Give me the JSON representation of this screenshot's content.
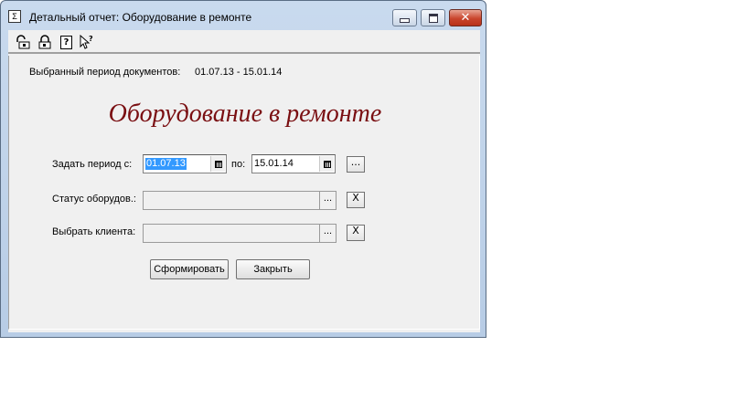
{
  "window": {
    "title": "Детальный отчет: Оборудование в ремонте",
    "title_icon_glyph": "Σ"
  },
  "toolbar": {
    "icons": [
      "open-lock-icon",
      "lock-icon",
      "help-icon",
      "context-help-icon"
    ]
  },
  "report": {
    "period_label": "Выбранный период документов:",
    "period_value": "01.07.13 - 15.01.14",
    "title": "Оборудование в ремонте",
    "title_color": "#7a0f12"
  },
  "form": {
    "period_from_label": "Задать период с:",
    "date_from": "01.07.13",
    "period_to_label": "по:",
    "date_to": "15.01.14",
    "period_select_button": "...",
    "status_label": "Статус оборудов.:",
    "status_value": "",
    "status_select_button": "...",
    "status_clear_button": "X",
    "client_label": "Выбрать клиента:",
    "client_value": "",
    "client_select_button": "...",
    "client_clear_button": "X"
  },
  "buttons": {
    "generate": "Сформировать",
    "close": "Закрыть"
  },
  "colors": {
    "selection": "#3399ff",
    "close_button": "#c9452d",
    "dialog_bg": "#f0f0f0"
  }
}
